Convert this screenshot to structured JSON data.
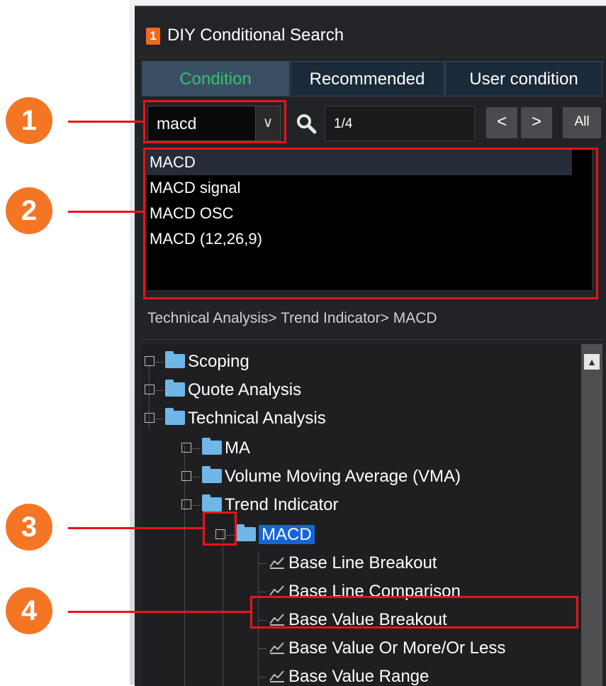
{
  "window": {
    "badge_number": "1",
    "title": "DIY Conditional Search"
  },
  "tabs": [
    {
      "label": "Condition",
      "active": true
    },
    {
      "label": "Recommended",
      "active": false
    },
    {
      "label": "User condition",
      "active": false
    }
  ],
  "search": {
    "query": "macd",
    "dropdown_arrow": "∨",
    "search_icon": "magnifier",
    "result_counter": "1/4",
    "prev_label": "<",
    "next_label": ">",
    "all_label": "All"
  },
  "results": [
    {
      "label": "MACD",
      "selected": true
    },
    {
      "label": "MACD signal",
      "selected": false
    },
    {
      "label": "MACD OSC",
      "selected": false
    },
    {
      "label": "MACD (12,26,9)",
      "selected": false
    }
  ],
  "breadcrumb": "Technical Analysis> Trend Indicator> MACD",
  "tree": {
    "scoping": "Scoping",
    "quote_analysis": "Quote Analysis",
    "technical_analysis": "Technical Analysis",
    "ma": "MA",
    "vma": "Volume Moving Average (VMA)",
    "trend_indicator": "Trend Indicator",
    "macd": "MACD",
    "leaves": [
      "Base Line Breakout",
      "Base Line Comparison",
      "Base Value Breakout",
      "Base Value Or More/Or Less",
      "Base Value Range"
    ]
  },
  "callouts": [
    "1",
    "2",
    "3",
    "4"
  ],
  "colors": {
    "accent_green": "#35c16f",
    "highlight_blue": "#1565d6",
    "callout_orange": "#f47625",
    "annotation_red": "#e8141b"
  }
}
